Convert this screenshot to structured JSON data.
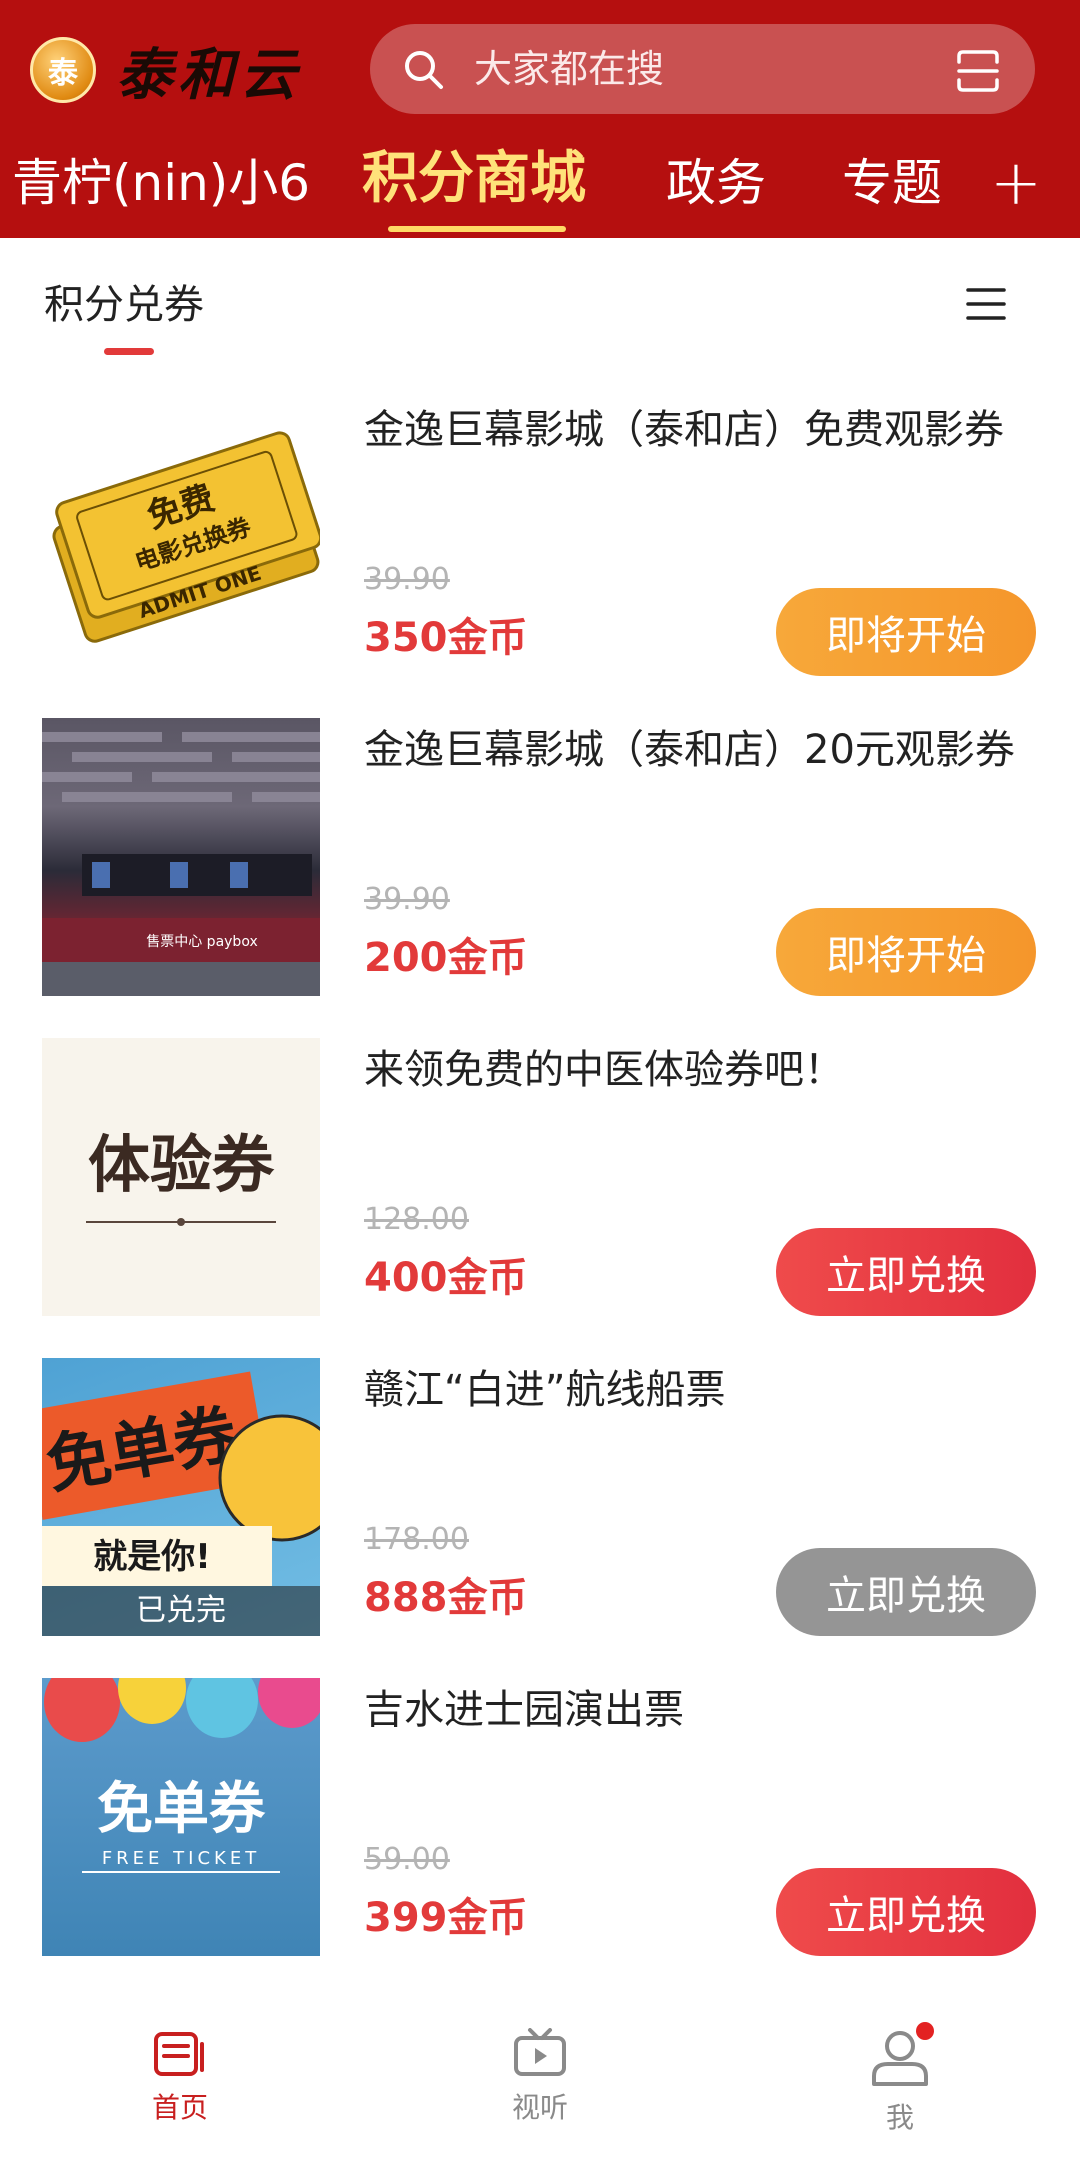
{
  "header": {
    "logo_badge": "泰",
    "logo_text": "泰和云",
    "search_placeholder": "大家都在搜",
    "nav": [
      {
        "label": "青柠(nin)小6",
        "active": false
      },
      {
        "label": "积分商城",
        "active": true
      },
      {
        "label": "政务",
        "active": false
      },
      {
        "label": "专题",
        "active": false
      }
    ],
    "plus_label": "+"
  },
  "subtabs": {
    "active_label": "积分兑券"
  },
  "items": [
    {
      "title": "金逸巨幕影城（泰和店）免费观影券",
      "orig_price": "39.90",
      "price": "350金币",
      "button": "即将开始",
      "button_style": "orange",
      "thumb_text": "免费",
      "thumb_sub": "电影兑换券",
      "thumb_foot": "ADMIT ONE"
    },
    {
      "title": "金逸巨幕影城（泰和店）20元观影券",
      "orig_price": "39.90",
      "price": "200金币",
      "button": "即将开始",
      "button_style": "orange",
      "thumb_text": "售票中心 paybox"
    },
    {
      "title": "来领免费的中医体验券吧！",
      "orig_price": "128.00",
      "price": "400金币",
      "button": "立即兑换",
      "button_style": "red",
      "thumb_text": "体验券"
    },
    {
      "title": "赣江“白进”航线船票",
      "orig_price": "178.00",
      "price": "888金币",
      "button": "立即兑换",
      "button_style": "gray",
      "thumb_text": "免单券",
      "thumb_sub": "就是你!",
      "soldout": "已兑完"
    },
    {
      "title": "吉水进士园演出票",
      "orig_price": "59.00",
      "price": "399金币",
      "button": "立即兑换",
      "button_style": "red",
      "thumb_text": "免单券",
      "thumb_sub": "FREE TICKET"
    }
  ],
  "tabbar": {
    "tabs": [
      {
        "label": "首页",
        "icon": "home-icon",
        "active": true
      },
      {
        "label": "视听",
        "icon": "tv-icon",
        "active": false
      },
      {
        "label": "我",
        "icon": "profile-icon",
        "active": false
      }
    ]
  },
  "colors": {
    "header_bg": "#b50f0f",
    "accent": "#e23a3a",
    "nav_active": "#ffe27a",
    "btn_orange": "#f5962b",
    "btn_gray": "#959595"
  }
}
